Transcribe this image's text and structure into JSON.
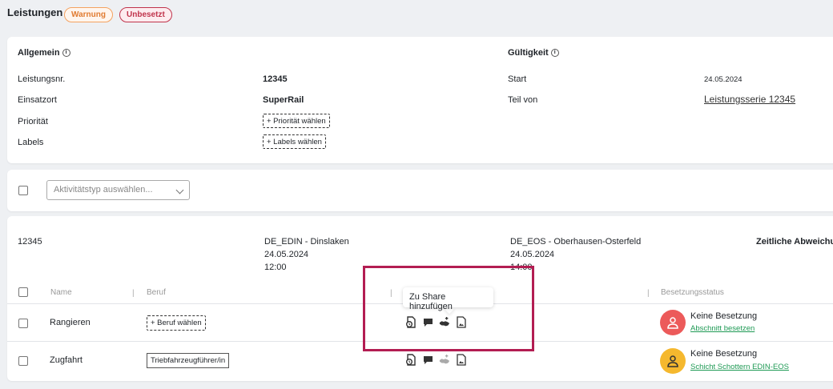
{
  "header": {
    "title": "Leistungen",
    "badge_warning": "Warnung",
    "badge_unbesetzt": "Unbesetzt"
  },
  "allgemein": {
    "title": "Allgemein",
    "leistungsnr_label": "Leistungsnr.",
    "leistungsnr_value": "12345",
    "einsatzort_label": "Einsatzort",
    "einsatzort_value": "SuperRail",
    "prioritaet_label": "Priorität",
    "prioritaet_button": "+ Priorität wählen",
    "labels_label": "Labels",
    "labels_button": "+ Labels wählen"
  },
  "gueltigkeit": {
    "title": "Gültigkeit",
    "start_label": "Start",
    "start_value": "24.05.2024",
    "teil_von_label": "Teil von",
    "teil_von_value": "Leistungsserie 12345"
  },
  "filter": {
    "placeholder": "Aktivitätstyp auswählen..."
  },
  "leistung": {
    "id": "12345",
    "from_station": "DE_EDIN - Dinslaken",
    "from_date": "24.05.2024",
    "from_time": "12:00",
    "to_station": "DE_EOS - Oberhausen-Osterfeld",
    "to_date": "24.05.2024",
    "to_time": "14:00",
    "zeitliche": "Zeitliche Abweichung"
  },
  "table": {
    "col_name": "Name",
    "col_beruf": "Beruf",
    "col_status": "Besetzungsstatus",
    "rows": [
      {
        "name": "Rangieren",
        "beruf": "+ Beruf wählen",
        "status": "Keine Besetzung",
        "status_link": "Abschnitt besetzen",
        "avatar_color": "#ec5a5a"
      },
      {
        "name": "Zugfahrt",
        "beruf": "Triebfahrzeugführer/in",
        "status": "Keine Besetzung",
        "status_link": "Schicht Schottern EDIN-EOS",
        "avatar_color": "#f5b82e"
      }
    ]
  },
  "tooltip": {
    "text": "Zu Share hinzufügen"
  },
  "icons": [
    "document-clock-icon",
    "comment-icon",
    "share-handshake-icon",
    "document-image-icon"
  ],
  "colors": {
    "highlight": "#b31d52",
    "link_green": "#1f9a55"
  }
}
